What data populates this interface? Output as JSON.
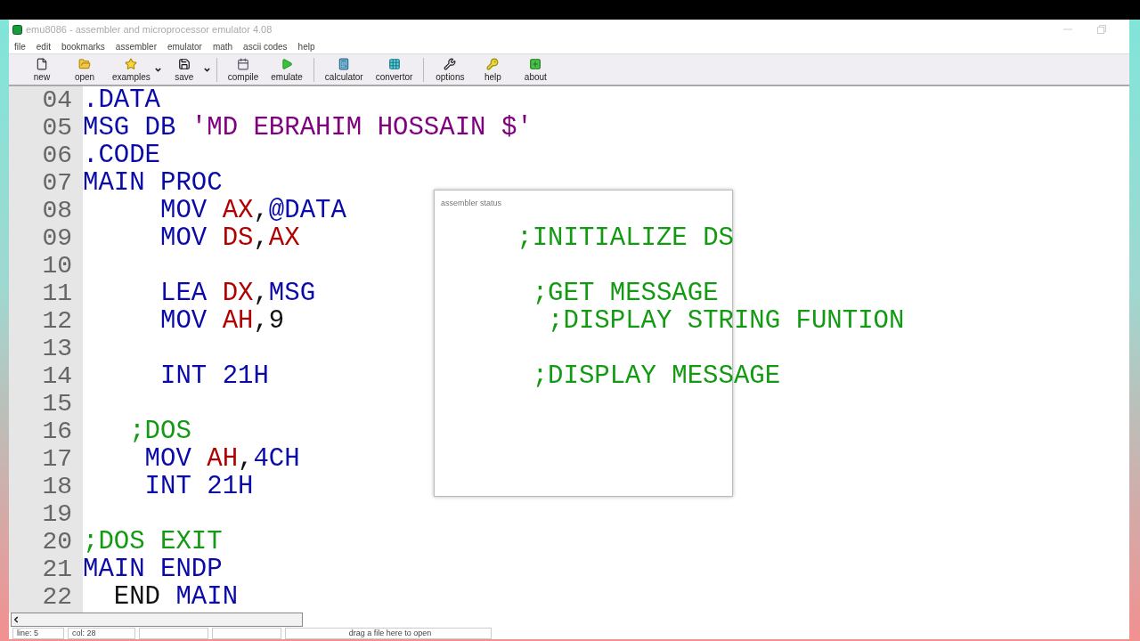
{
  "window": {
    "title": "emu8086 - assembler and microprocessor emulator 4.08"
  },
  "menu": [
    "file",
    "edit",
    "bookmarks",
    "assembler",
    "emulator",
    "math",
    "ascii codes",
    "help"
  ],
  "toolbar": [
    [
      {
        "label": "new",
        "dropdown": false
      },
      {
        "label": "open",
        "dropdown": false
      },
      {
        "label": "examples",
        "dropdown": true
      },
      {
        "label": "save",
        "dropdown": true
      }
    ],
    [
      {
        "label": "compile",
        "dropdown": false
      },
      {
        "label": "emulate",
        "dropdown": false
      }
    ],
    [
      {
        "label": "calculator",
        "dropdown": false
      },
      {
        "label": "convertor",
        "dropdown": false
      }
    ],
    [
      {
        "label": "options",
        "dropdown": false
      },
      {
        "label": "help",
        "dropdown": false
      },
      {
        "label": "about",
        "dropdown": false
      }
    ]
  ],
  "editor": {
    "lines": [
      {
        "number": "04",
        "tokens": [
          {
            "text": ".DATA",
            "kind": "keyword"
          }
        ]
      },
      {
        "number": "05",
        "tokens": [
          {
            "text": "MSG DB ",
            "kind": "keyword"
          },
          {
            "text": "'MD EBRAHIM HOSSAIN $'",
            "kind": "string"
          }
        ]
      },
      {
        "number": "06",
        "tokens": [
          {
            "text": ".CODE",
            "kind": "keyword"
          }
        ]
      },
      {
        "number": "07",
        "tokens": [
          {
            "text": "MAIN PROC",
            "kind": "keyword"
          }
        ]
      },
      {
        "number": "08",
        "tokens": [
          {
            "text": "     MOV ",
            "kind": "keyword"
          },
          {
            "text": "AX",
            "kind": "register"
          },
          {
            "text": ",",
            "kind": "plain"
          },
          {
            "text": "@DATA",
            "kind": "keyword"
          }
        ]
      },
      {
        "number": "09",
        "tokens": [
          {
            "text": "     MOV ",
            "kind": "keyword"
          },
          {
            "text": "DS",
            "kind": "register"
          },
          {
            "text": ",",
            "kind": "plain"
          },
          {
            "text": "AX",
            "kind": "register"
          },
          {
            "text": "              ;INITIALIZE DS",
            "kind": "comment"
          }
        ]
      },
      {
        "number": "10"
      },
      {
        "number": "11",
        "tokens": [
          {
            "text": "     LEA ",
            "kind": "keyword"
          },
          {
            "text": "DX",
            "kind": "register"
          },
          {
            "text": ",",
            "kind": "plain"
          },
          {
            "text": "MSG",
            "kind": "keyword"
          },
          {
            "text": "              ;GET MESSAGE",
            "kind": "comment"
          }
        ]
      },
      {
        "number": "12",
        "tokens": [
          {
            "text": "     MOV ",
            "kind": "keyword"
          },
          {
            "text": "AH",
            "kind": "register"
          },
          {
            "text": ",9",
            "kind": "plain"
          },
          {
            "text": "                 ;DISPLAY STRING FUNTION",
            "kind": "comment"
          }
        ]
      },
      {
        "number": "13"
      },
      {
        "number": "14",
        "tokens": [
          {
            "text": "     INT 21H",
            "kind": "keyword"
          },
          {
            "text": "                 ;DISPLAY MESSAGE",
            "kind": "comment"
          }
        ]
      },
      {
        "number": "15"
      },
      {
        "number": "16",
        "tokens": [
          {
            "text": "   ;DOS",
            "kind": "comment"
          }
        ]
      },
      {
        "number": "17",
        "tokens": [
          {
            "text": "    MOV ",
            "kind": "keyword"
          },
          {
            "text": "AH",
            "kind": "register"
          },
          {
            "text": ",",
            "kind": "plain"
          },
          {
            "text": "4CH",
            "kind": "keyword"
          }
        ]
      },
      {
        "number": "18",
        "tokens": [
          {
            "text": "    INT 21H",
            "kind": "keyword"
          }
        ]
      },
      {
        "number": "19"
      },
      {
        "number": "20",
        "tokens": [
          {
            "text": ";DOS EXIT",
            "kind": "comment"
          }
        ]
      },
      {
        "number": "21",
        "tokens": [
          {
            "text": "MAIN ENDP",
            "kind": "keyword"
          }
        ]
      },
      {
        "number": "22",
        "tokens": [
          {
            "text": "  END ",
            "kind": "plain"
          },
          {
            "text": "MAIN",
            "kind": "keyword"
          }
        ]
      }
    ]
  },
  "dialog": {
    "title": "assembler status"
  },
  "status_bar": {
    "line": "line: 5",
    "col": "col: 28",
    "hint": "drag a file here to open"
  }
}
